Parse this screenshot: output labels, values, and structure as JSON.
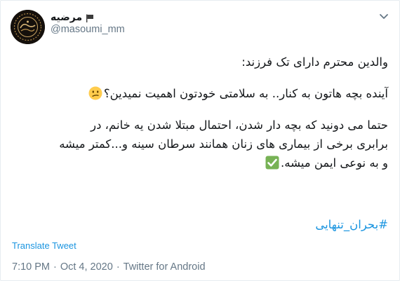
{
  "author": {
    "display_name": "مرضیه",
    "handle": "@masoumi_mm",
    "name_badge_icon": "flag-icon"
  },
  "menu": {
    "icon": "chevron-down-icon"
  },
  "tweet": {
    "line1": "والدین محترم دارای تک فرزند:",
    "line2": "آینده بچه هاتون به کنار.. به سلامتی خودتون اهمیت نمیدین؟",
    "line2_emoji": "confused-face-emoji",
    "line3": "حتما می دونید که بچه دار شدن، احتمال مبتلا شدن یه خانم، در",
    "line4": "برابری برخی از بیماری های زنان همانند سرطان سینه و...کمتر میشه",
    "line5": "و به نوعی ایمن میشه.",
    "line5_emoji": "check-mark-emoji",
    "hashtag": "#بحران_تنهایی"
  },
  "translate_label": "Translate Tweet",
  "meta": {
    "time": "7:10 PM",
    "separator1": "·",
    "date": "Oct 4, 2020",
    "separator2": "·",
    "source": "Twitter for Android"
  },
  "colors": {
    "link": "#1b95e0",
    "secondary_text": "#657786",
    "primary_text": "#14171a",
    "check_emoji_bg": "#77b255",
    "confused_emoji_bg": "#ffcc4d"
  }
}
